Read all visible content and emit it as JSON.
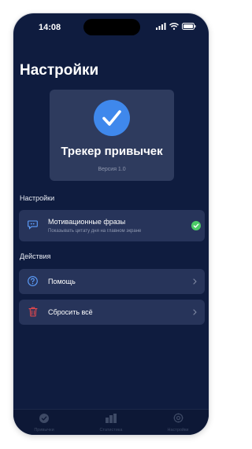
{
  "status_bar": {
    "time": "14:08"
  },
  "page": {
    "title": "Настройки"
  },
  "app_card": {
    "name": "Трекер привычек",
    "version": "Версия 1.0"
  },
  "sections": {
    "settings": "Настройки",
    "actions": "Действия"
  },
  "motivation": {
    "title": "Мотивационные фразы",
    "subtitle": "Показывать цитату дня на главном экране",
    "enabled": true
  },
  "actions": {
    "help": "Помощь",
    "reset": "Сбросить всё"
  },
  "tabs": [
    {
      "label": "Привычки",
      "icon": "check-circle-icon"
    },
    {
      "label": "Статистика",
      "icon": "bar-chart-icon"
    },
    {
      "label": "Настройки",
      "icon": "gear-icon"
    }
  ],
  "colors": {
    "background": "#0f1c3f",
    "card": "#27345a",
    "accent": "#3f88ec",
    "success": "#4ccb67",
    "danger": "#e5484d"
  }
}
